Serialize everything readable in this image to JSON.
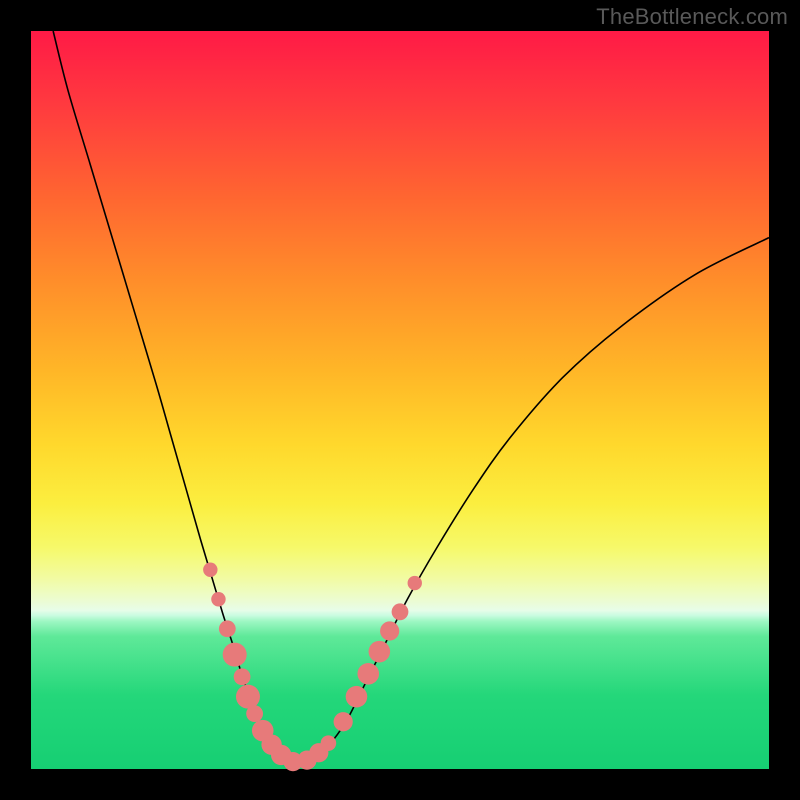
{
  "watermark": "TheBottleneck.com",
  "chart_data": {
    "type": "line",
    "title": "",
    "xlabel": "",
    "ylabel": "",
    "xlim": [
      0,
      100
    ],
    "ylim": [
      0,
      100
    ],
    "series": [
      {
        "name": "bottleneck-curve",
        "x": [
          3,
          5,
          8,
          11,
          14,
          17,
          19,
          21,
          23,
          24.5,
          26,
          27.3,
          28.5,
          29.5,
          30.5,
          31.5,
          32.5,
          33.5,
          35,
          37,
          39,
          41,
          43,
          45,
          48,
          51,
          55,
          60,
          65,
          72,
          80,
          90,
          100
        ],
        "y": [
          100,
          92,
          82,
          72,
          62,
          52,
          45,
          38,
          31,
          26,
          21,
          17,
          13,
          10,
          7,
          5,
          3,
          2,
          1,
          1,
          2,
          4,
          7,
          11,
          17,
          23,
          30,
          38,
          45,
          53,
          60,
          67,
          72
        ]
      }
    ],
    "markers": {
      "name": "highlighted-points",
      "color": "#e77a7a",
      "points": [
        {
          "x": 24.3,
          "y": 27.0,
          "r": 1.2
        },
        {
          "x": 25.4,
          "y": 23.0,
          "r": 1.2
        },
        {
          "x": 26.6,
          "y": 19.0,
          "r": 1.4
        },
        {
          "x": 27.6,
          "y": 15.5,
          "r": 2.0
        },
        {
          "x": 28.6,
          "y": 12.5,
          "r": 1.4
        },
        {
          "x": 29.4,
          "y": 9.8,
          "r": 2.0
        },
        {
          "x": 30.3,
          "y": 7.5,
          "r": 1.4
        },
        {
          "x": 31.4,
          "y": 5.2,
          "r": 1.8
        },
        {
          "x": 32.6,
          "y": 3.3,
          "r": 1.7
        },
        {
          "x": 33.9,
          "y": 1.9,
          "r": 1.7
        },
        {
          "x": 35.5,
          "y": 1.0,
          "r": 1.6
        },
        {
          "x": 37.4,
          "y": 1.2,
          "r": 1.6
        },
        {
          "x": 39.0,
          "y": 2.2,
          "r": 1.6
        },
        {
          "x": 40.3,
          "y": 3.5,
          "r": 1.3
        },
        {
          "x": 42.3,
          "y": 6.4,
          "r": 1.6
        },
        {
          "x": 44.1,
          "y": 9.8,
          "r": 1.8
        },
        {
          "x": 45.7,
          "y": 12.9,
          "r": 1.8
        },
        {
          "x": 47.2,
          "y": 15.9,
          "r": 1.8
        },
        {
          "x": 48.6,
          "y": 18.7,
          "r": 1.6
        },
        {
          "x": 50.0,
          "y": 21.3,
          "r": 1.4
        },
        {
          "x": 52.0,
          "y": 25.2,
          "r": 1.2
        }
      ]
    },
    "background_gradient": {
      "top": "#ff1a46",
      "mid": "#ffe23a",
      "bottom": "#16cf73"
    }
  }
}
